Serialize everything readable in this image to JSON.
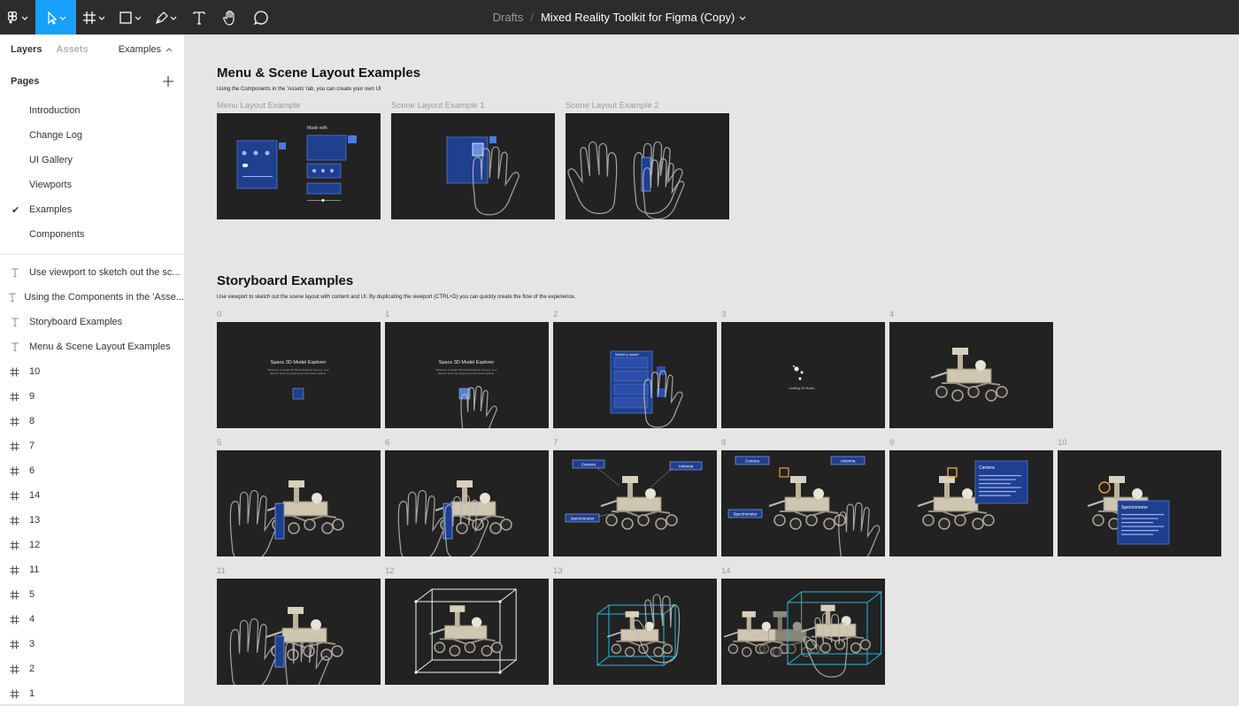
{
  "toolbar": {
    "tools": [
      "main-menu",
      "move",
      "frame",
      "shape",
      "pen",
      "text",
      "hand",
      "comment"
    ],
    "breadcrumb": "Drafts",
    "separator": "/",
    "file_name": "Mixed Reality Toolkit for Figma (Copy)"
  },
  "sidebar": {
    "tabs": [
      "Layers",
      "Assets"
    ],
    "current_page": "Examples",
    "pages_heading": "Pages",
    "pages": [
      "Introduction",
      "Change Log",
      "UI Gallery",
      "Viewports",
      "Examples",
      "Components"
    ],
    "selected_page_index": 4,
    "layers": [
      {
        "type": "text-icon",
        "label": "Use viewport to sketch out the sc..."
      },
      {
        "type": "text-icon",
        "label": "Using the Components in the 'Asse..."
      },
      {
        "type": "text-icon",
        "label": "Storyboard Examples"
      },
      {
        "type": "text-icon",
        "label": "Menu & Scene Layout Examples"
      },
      {
        "type": "frame-icon",
        "label": "10"
      },
      {
        "type": "frame-icon",
        "label": "9"
      },
      {
        "type": "frame-icon",
        "label": "8"
      },
      {
        "type": "frame-icon",
        "label": "7"
      },
      {
        "type": "frame-icon",
        "label": "6"
      },
      {
        "type": "frame-icon",
        "label": "14"
      },
      {
        "type": "frame-icon",
        "label": "13"
      },
      {
        "type": "frame-icon",
        "label": "12"
      },
      {
        "type": "frame-icon",
        "label": "11"
      },
      {
        "type": "frame-icon",
        "label": "5"
      },
      {
        "type": "frame-icon",
        "label": "4"
      },
      {
        "type": "frame-icon",
        "label": "3"
      },
      {
        "type": "frame-icon",
        "label": "2"
      },
      {
        "type": "frame-icon",
        "label": "1"
      }
    ]
  },
  "canvas": {
    "menu_section": {
      "title": "Menu & Scene Layout Examples",
      "subtitle": "Using the Components in the 'Assets' tab, you can create your own UI",
      "frames": [
        "Menu Layout Example",
        "Scene Layout Example 1",
        "Scene Layout Example 2"
      ]
    },
    "storyboard_section": {
      "title": "Storyboard Examples",
      "subtitle": "Use viewport to sketch out the scene layout with content and UI. By duplicating the viewport (CTRL+D) you can quickly create the flow of the experience.",
      "frames": [
        "0",
        "1",
        "2",
        "3",
        "4",
        "5",
        "6",
        "7",
        "8",
        "9",
        "10",
        "11",
        "12",
        "13",
        "14"
      ]
    },
    "frame_texts": {
      "explorer_title": "Space 3D Model Explorer",
      "explorer_body": "Welcome to Space 3D Model Explorer bring up your hand to open the hand menu and select options.",
      "select_model": "Select a model",
      "loading": "Loading 3D Model...",
      "made_with": "Made with",
      "camera": "Camera",
      "antenna": "Antenna",
      "spectrometer": "Spectrometer",
      "camera_body": "Lorem ipsum dolor sit amet consectetur adipiscing elit sed do eiusmod tempor incididunt ut labore et dolore magna aliqua.",
      "spectrometer_title": "Spectrometer",
      "spectrometer_body": "Lorem ipsum dolor sit amet consectetur adipiscing elit sed do eiusmod tempor incididunt ut labore et dolore magna aliqua ut enim ad minim veniam quis nostrud."
    }
  },
  "colors": {
    "toolbar_bg": "#2c2c2c",
    "active_tool": "#18a0fb",
    "canvas_bg": "#e5e5e5",
    "frame_bg": "#222222",
    "mrtk_blue": "#1f3f8f",
    "highlight_orange": "#f0a030",
    "bounds_cyan": "#29b6e0"
  }
}
